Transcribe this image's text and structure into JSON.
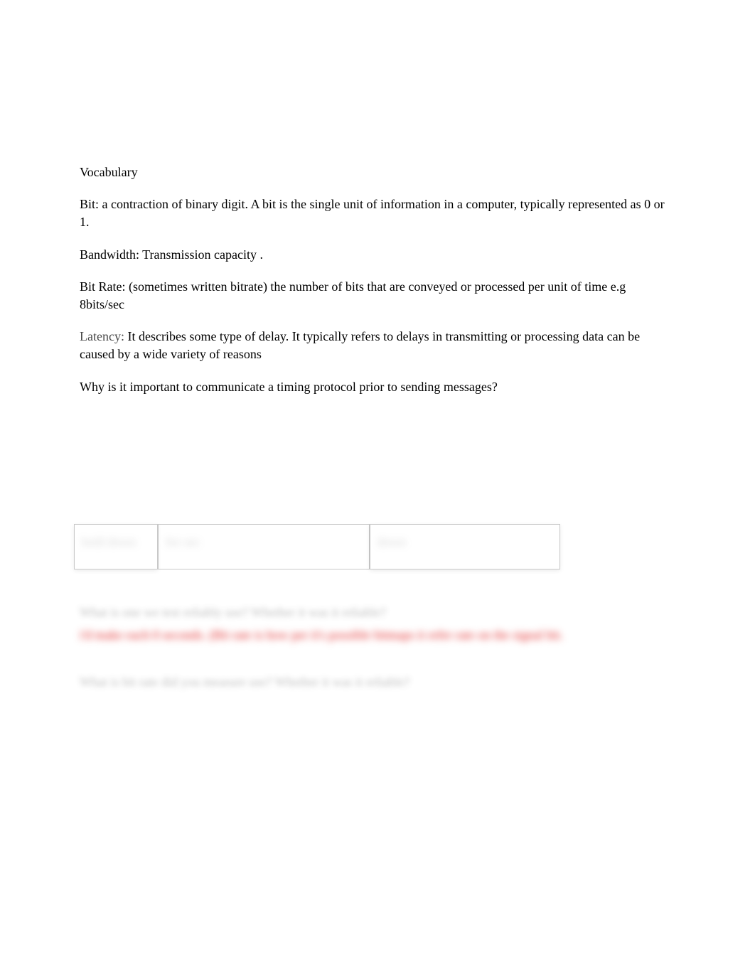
{
  "heading": "Vocabulary",
  "definitions": {
    "bit": "Bit: a contraction of binary digit. A bit is the single unit of information in a computer, typically represented as 0 or 1.",
    "bandwidth": "Bandwidth: Transmission capacity .",
    "bitrate": "Bit Rate: (sometimes written bitrate) the number of bits that are conveyed or processed per unit of time e.g 8bits/sec",
    "latency_label": "Latency:",
    "latency_text": "  It describes some type of delay. It typically refers to delays in transmitting or processing data can be caused by a wide variety of reasons"
  },
  "question": "Why is it important to communicate a timing protocol prior to sending messages?",
  "table": {
    "c1": "hold down",
    "c2": "for                                   sec",
    "c3": "down"
  },
  "blurred": {
    "q1": "What is one we test reliably use? Whether it was it reliable?",
    "answer": "i'd make each 0 seconds. (Bit rate is how per it's possible bitmaps it refer rate on the signal hit.",
    "q2": "What is bit rate did you measure use? Whether it was it reliable?"
  }
}
